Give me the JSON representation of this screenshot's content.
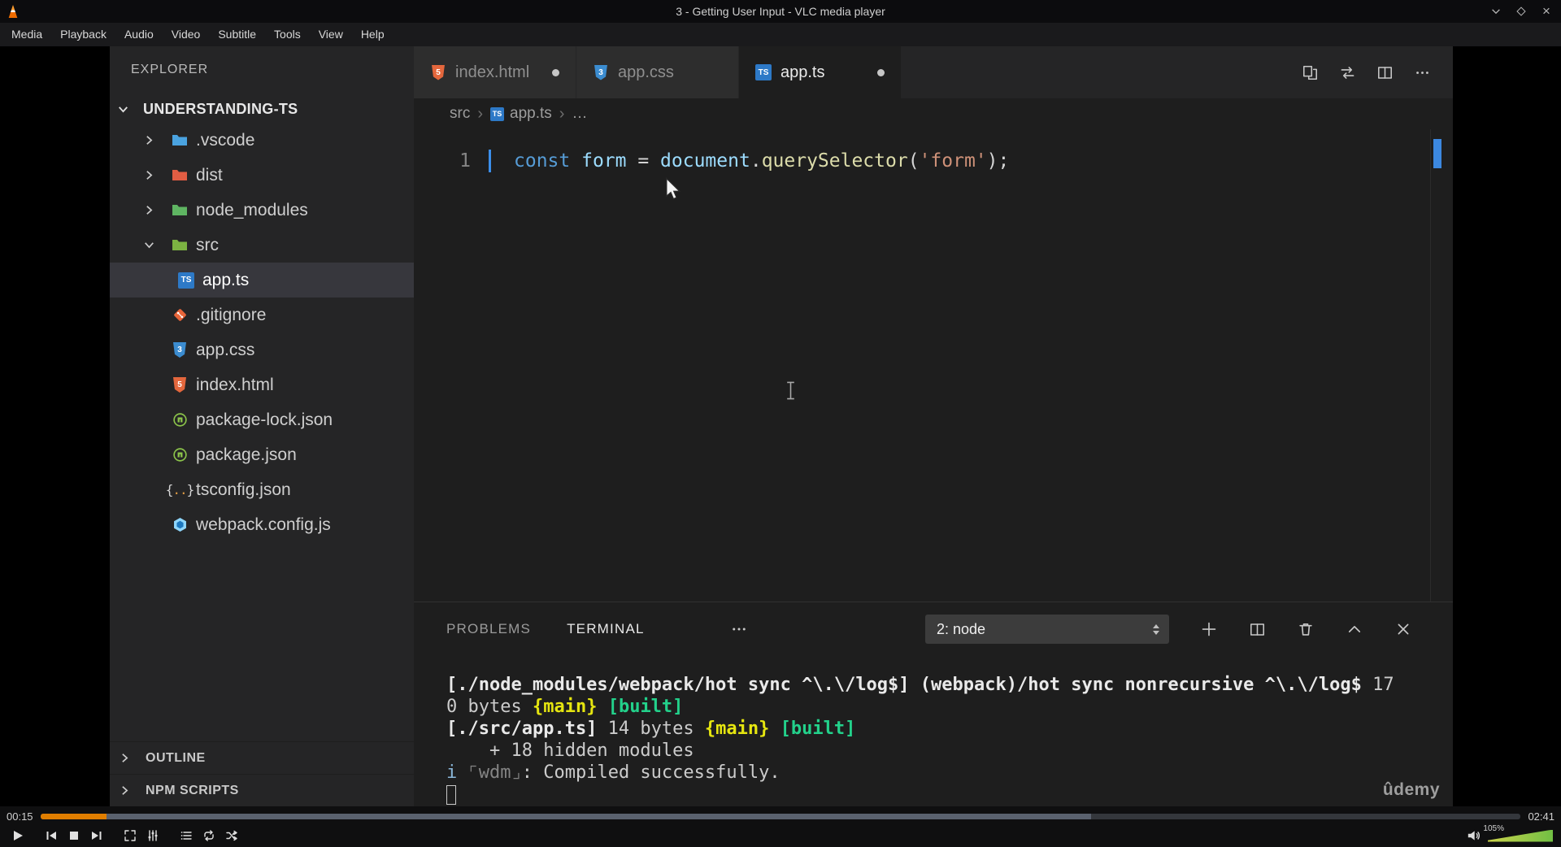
{
  "window": {
    "title": "3 - Getting User Input - VLC media player",
    "controls": [
      {
        "name": "minimize",
        "icon": "chevron-down-icon"
      },
      {
        "name": "maximize",
        "icon": "diamond-icon"
      },
      {
        "name": "close",
        "icon": "close-icon",
        "glyph": "×"
      }
    ]
  },
  "menubar": {
    "items": [
      "Media",
      "Playback",
      "Audio",
      "Video",
      "Subtitle",
      "Tools",
      "View",
      "Help"
    ]
  },
  "vscode": {
    "explorer": {
      "header": "EXPLORER",
      "root": {
        "label": "UNDERSTANDING-TS",
        "expanded": true
      },
      "items": [
        {
          "label": ".vscode",
          "kind": "folder",
          "color": "#4aa3e0",
          "expanded": false
        },
        {
          "label": "dist",
          "kind": "folder",
          "color": "#e25d43",
          "expanded": false
        },
        {
          "label": "node_modules",
          "kind": "folder",
          "color": "#5fb562",
          "expanded": false
        },
        {
          "label": "src",
          "kind": "folder",
          "color": "#7cb342",
          "expanded": true
        },
        {
          "label": "app.ts",
          "kind": "typescript",
          "nested": true,
          "selected": true
        },
        {
          "label": ".gitignore",
          "kind": "git"
        },
        {
          "label": "app.css",
          "kind": "css"
        },
        {
          "label": "index.html",
          "kind": "html"
        },
        {
          "label": "package-lock.json",
          "kind": "npm"
        },
        {
          "label": "package.json",
          "kind": "npm"
        },
        {
          "label": "tsconfig.json",
          "kind": "braces"
        },
        {
          "label": "webpack.config.js",
          "kind": "webpack"
        }
      ],
      "sections": [
        "OUTLINE",
        "NPM SCRIPTS"
      ]
    },
    "editor_tabs": [
      {
        "label": "index.html",
        "kind": "html",
        "modified": true,
        "active": false
      },
      {
        "label": "app.css",
        "kind": "css",
        "modified": false,
        "active": false
      },
      {
        "label": "app.ts",
        "kind": "typescript",
        "modified": true,
        "active": true
      }
    ],
    "editor_actions": [
      "open-changes",
      "synchronize-changes",
      "split-editor",
      "more-actions"
    ],
    "breadcrumb": [
      {
        "label": "src"
      },
      {
        "label": "app.ts",
        "icon": "typescript"
      },
      {
        "label": "…"
      }
    ],
    "editor": {
      "lines": [
        {
          "number": "1",
          "cursor": true,
          "segments": [
            {
              "t": "const ",
              "c": "keyword"
            },
            {
              "t": "form ",
              "c": "variable"
            },
            {
              "t": "= ",
              "c": "default"
            },
            {
              "t": "document",
              "c": "variable"
            },
            {
              "t": ".",
              "c": "default"
            },
            {
              "t": "querySelector",
              "c": "function"
            },
            {
              "t": "(",
              "c": "default"
            },
            {
              "t": "'form'",
              "c": "string"
            },
            {
              "t": ");",
              "c": "default"
            }
          ]
        }
      ]
    },
    "panel": {
      "tabs": [
        {
          "label": "PROBLEMS",
          "active": false
        },
        {
          "label": "TERMINAL",
          "active": true
        }
      ],
      "terminal_picker": {
        "value": "2: node"
      },
      "actions": [
        "new-terminal",
        "split-terminal",
        "kill-terminal",
        "maximize-panel",
        "close-panel"
      ],
      "terminal_lines": [
        {
          "segments": [
            {
              "t": "[./node_modules/webpack/hot sync ^\\.\\/log$]",
              "s": "bold"
            },
            {
              "t": " ",
              "s": "plain"
            },
            {
              "t": "(webpack)/hot sync nonrecursive ^\\.\\/log$",
              "s": "bold"
            },
            {
              "t": " 17",
              "s": "plain"
            }
          ]
        },
        {
          "segments": [
            {
              "t": "0 bytes ",
              "s": "plain"
            },
            {
              "t": "{main}",
              "s": "yellow"
            },
            {
              "t": " ",
              "s": "plain"
            },
            {
              "t": "[built]",
              "s": "green"
            }
          ]
        },
        {
          "segments": [
            {
              "t": "[./src/app.ts]",
              "s": "bold"
            },
            {
              "t": " 14 bytes ",
              "s": "plain"
            },
            {
              "t": "{main}",
              "s": "yellow"
            },
            {
              "t": " ",
              "s": "plain"
            },
            {
              "t": "[built]",
              "s": "green"
            }
          ]
        },
        {
          "segments": [
            {
              "t": "    + 18 hidden modules",
              "s": "plain"
            }
          ]
        },
        {
          "segments": [
            {
              "t": "i",
              "s": "info"
            },
            {
              "t": " ⌜wdm⌟",
              "s": "dim"
            },
            {
              "t": ": Compiled successfully.",
              "s": "plain"
            }
          ]
        }
      ],
      "watermark": "ûdemy"
    }
  },
  "player": {
    "time_elapsed": "00:15",
    "time_total": "02:41",
    "progress_percent": 4.5,
    "buffered_percent": 71,
    "volume_label": "105%",
    "buttons": [
      "play",
      "previous",
      "stop",
      "next",
      "fullscreen",
      "extended-settings",
      "playlist",
      "loop",
      "random"
    ],
    "colors": {
      "seek_played": "#e07e00",
      "seek_buffered": "#5a616e",
      "volume_low": "#cbd34b",
      "volume_high": "#71bf44"
    }
  }
}
